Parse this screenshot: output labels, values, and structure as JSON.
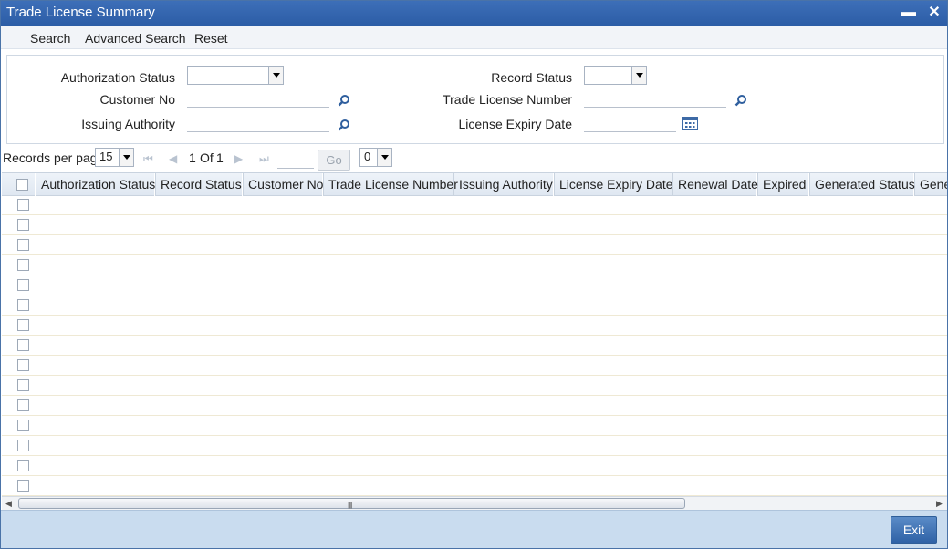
{
  "window": {
    "title": "Trade License Summary",
    "minimize_glyph": "▬",
    "close_glyph": "✕"
  },
  "menu": {
    "search": "Search",
    "advanced_search": "Advanced Search",
    "reset": "Reset"
  },
  "criteria": {
    "authorization_status_label": "Authorization Status",
    "customer_no_label": "Customer No",
    "issuing_authority_label": "Issuing Authority",
    "record_status_label": "Record Status",
    "trade_license_number_label": "Trade License Number",
    "license_expiry_date_label": "License Expiry Date",
    "authorization_status_value": "",
    "record_status_value": "",
    "customer_no_value": "",
    "issuing_authority_value": "",
    "trade_license_number_value": "",
    "license_expiry_date_value": ""
  },
  "pager": {
    "records_per_page_label": "Records per page",
    "records_per_page_value": "15",
    "current_page": "1",
    "of_label": "Of",
    "total_pages": "1",
    "go_label": "Go",
    "page_select_value": "0",
    "first_glyph": "⏮",
    "prev_glyph": "◀",
    "next_glyph": "▶",
    "last_glyph": "⏭"
  },
  "grid": {
    "columns": [
      "Authorization Status",
      "Record Status",
      "Customer No",
      "Trade License Number",
      "Issuing Authority",
      "License Expiry Date",
      "Renewal Date",
      "Expired",
      "Generated Status",
      "Gene"
    ],
    "row_count": 15
  },
  "scrollbar": {
    "left_glyph": "◀",
    "right_glyph": "▶",
    "grip": "||||"
  },
  "footer": {
    "exit_label": "Exit"
  },
  "icons": {
    "search_icon": "magnifier",
    "calendar_icon": "calendar",
    "dropdown_icon": "chevron-down"
  }
}
